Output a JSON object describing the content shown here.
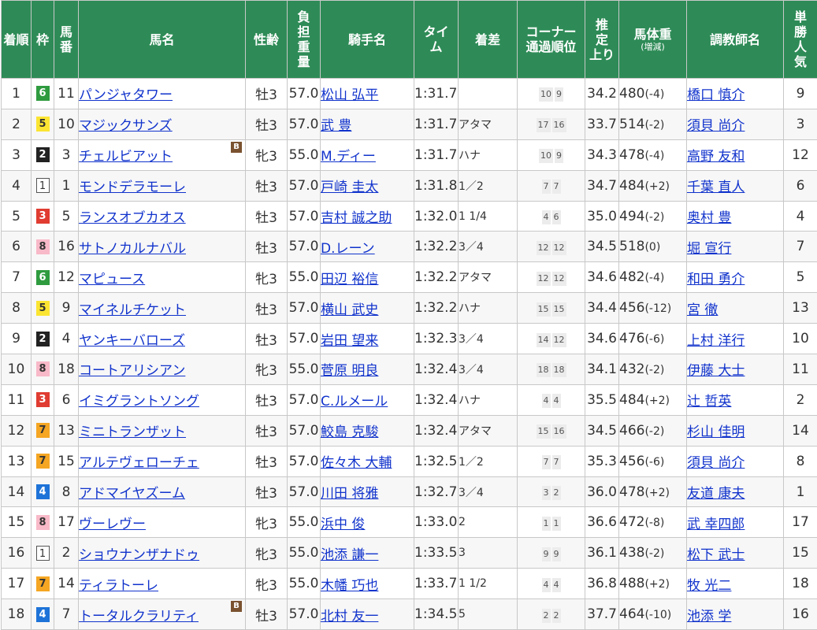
{
  "headers": {
    "finish": "着順",
    "frame": "枠",
    "horse_no": "馬番",
    "horse": "馬名",
    "sex_age": "性齢",
    "weight_carried": "負担重量",
    "jockey": "騎手名",
    "time": "タイム",
    "margin": "着差",
    "corner": "コーナー通過順位",
    "last3f": "推定上り",
    "horse_weight": "馬体重",
    "horse_weight_sub": "(増減)",
    "trainer": "調教師名",
    "popularity": "単勝人気"
  },
  "blinker_label": "B",
  "frame_colors": {
    "1": "#ffffff",
    "2": "#222222",
    "3": "#e03c31",
    "4": "#1e73d8",
    "5": "#fbe532",
    "6": "#2f9b3f",
    "7": "#f5a623",
    "8": "#f8b9c8"
  },
  "rows": [
    {
      "finish": "1",
      "frame": "6",
      "horse_no": "11",
      "horse": "パンジャタワー",
      "blinker": false,
      "sex_age": "牡3",
      "weight_carried": "57.0",
      "jockey": "松山 弘平",
      "time": "1:31.7",
      "margin": "",
      "corner": [
        "10",
        "9"
      ],
      "last3f": "34.2",
      "horse_weight": "480",
      "weight_diff": "(-4)",
      "trainer": "橋口 慎介",
      "popularity": "9"
    },
    {
      "finish": "2",
      "frame": "5",
      "horse_no": "10",
      "horse": "マジックサンズ",
      "blinker": false,
      "sex_age": "牡3",
      "weight_carried": "57.0",
      "jockey": "武 豊",
      "time": "1:31.7",
      "margin": "アタマ",
      "corner": [
        "17",
        "16"
      ],
      "last3f": "33.7",
      "horse_weight": "514",
      "weight_diff": "(-2)",
      "trainer": "須貝 尚介",
      "popularity": "3"
    },
    {
      "finish": "3",
      "frame": "2",
      "horse_no": "3",
      "horse": "チェルビアット",
      "blinker": true,
      "sex_age": "牝3",
      "weight_carried": "55.0",
      "jockey": "M.ディー",
      "time": "1:31.7",
      "margin": "ハナ",
      "corner": [
        "10",
        "9"
      ],
      "last3f": "34.3",
      "horse_weight": "478",
      "weight_diff": "(-4)",
      "trainer": "高野 友和",
      "popularity": "12"
    },
    {
      "finish": "4",
      "frame": "1",
      "horse_no": "1",
      "horse": "モンドデラモーレ",
      "blinker": false,
      "sex_age": "牡3",
      "weight_carried": "57.0",
      "jockey": "戸崎 圭太",
      "time": "1:31.8",
      "margin": "1／2",
      "corner": [
        "7",
        "7"
      ],
      "last3f": "34.7",
      "horse_weight": "484",
      "weight_diff": "(+2)",
      "trainer": "千葉 直人",
      "popularity": "6"
    },
    {
      "finish": "5",
      "frame": "3",
      "horse_no": "5",
      "horse": "ランスオブカオス",
      "blinker": false,
      "sex_age": "牡3",
      "weight_carried": "57.0",
      "jockey": "吉村 誠之助",
      "time": "1:32.0",
      "margin": "1 1/4",
      "corner": [
        "4",
        "6"
      ],
      "last3f": "35.0",
      "horse_weight": "494",
      "weight_diff": "(-2)",
      "trainer": "奥村 豊",
      "popularity": "4"
    },
    {
      "finish": "6",
      "frame": "8",
      "horse_no": "16",
      "horse": "サトノカルナバル",
      "blinker": false,
      "sex_age": "牡3",
      "weight_carried": "57.0",
      "jockey": "D.レーン",
      "time": "1:32.2",
      "margin": "3／4",
      "corner": [
        "12",
        "12"
      ],
      "last3f": "34.5",
      "horse_weight": "518",
      "weight_diff": "(0)",
      "trainer": "堀 宣行",
      "popularity": "7"
    },
    {
      "finish": "7",
      "frame": "6",
      "horse_no": "12",
      "horse": "マピュース",
      "blinker": false,
      "sex_age": "牝3",
      "weight_carried": "55.0",
      "jockey": "田辺 裕信",
      "time": "1:32.2",
      "margin": "アタマ",
      "corner": [
        "12",
        "12"
      ],
      "last3f": "34.6",
      "horse_weight": "482",
      "weight_diff": "(-4)",
      "trainer": "和田 勇介",
      "popularity": "5"
    },
    {
      "finish": "8",
      "frame": "5",
      "horse_no": "9",
      "horse": "マイネルチケット",
      "blinker": false,
      "sex_age": "牡3",
      "weight_carried": "57.0",
      "jockey": "横山 武史",
      "time": "1:32.2",
      "margin": "ハナ",
      "corner": [
        "15",
        "15"
      ],
      "last3f": "34.4",
      "horse_weight": "456",
      "weight_diff": "(-12)",
      "trainer": "宮 徹",
      "popularity": "13"
    },
    {
      "finish": "9",
      "frame": "2",
      "horse_no": "4",
      "horse": "ヤンキーバローズ",
      "blinker": false,
      "sex_age": "牡3",
      "weight_carried": "57.0",
      "jockey": "岩田 望来",
      "time": "1:32.3",
      "margin": "3／4",
      "corner": [
        "14",
        "12"
      ],
      "last3f": "34.6",
      "horse_weight": "476",
      "weight_diff": "(-6)",
      "trainer": "上村 洋行",
      "popularity": "10"
    },
    {
      "finish": "10",
      "frame": "8",
      "horse_no": "18",
      "horse": "コートアリシアン",
      "blinker": false,
      "sex_age": "牝3",
      "weight_carried": "55.0",
      "jockey": "菅原 明良",
      "time": "1:32.4",
      "margin": "3／4",
      "corner": [
        "18",
        "18"
      ],
      "last3f": "34.1",
      "horse_weight": "432",
      "weight_diff": "(-2)",
      "trainer": "伊藤 大士",
      "popularity": "11"
    },
    {
      "finish": "11",
      "frame": "3",
      "horse_no": "6",
      "horse": "イミグラントソング",
      "blinker": false,
      "sex_age": "牡3",
      "weight_carried": "57.0",
      "jockey": "C.ルメール",
      "time": "1:32.4",
      "margin": "ハナ",
      "corner": [
        "4",
        "4"
      ],
      "last3f": "35.5",
      "horse_weight": "484",
      "weight_diff": "(+2)",
      "trainer": "辻 哲英",
      "popularity": "2"
    },
    {
      "finish": "12",
      "frame": "7",
      "horse_no": "13",
      "horse": "ミニトランザット",
      "blinker": false,
      "sex_age": "牡3",
      "weight_carried": "57.0",
      "jockey": "鮫島 克駿",
      "time": "1:32.4",
      "margin": "アタマ",
      "corner": [
        "15",
        "16"
      ],
      "last3f": "34.5",
      "horse_weight": "466",
      "weight_diff": "(-2)",
      "trainer": "杉山 佳明",
      "popularity": "14"
    },
    {
      "finish": "13",
      "frame": "7",
      "horse_no": "15",
      "horse": "アルテヴェローチェ",
      "blinker": false,
      "sex_age": "牡3",
      "weight_carried": "57.0",
      "jockey": "佐々木 大輔",
      "time": "1:32.5",
      "margin": "1／2",
      "corner": [
        "7",
        "7"
      ],
      "last3f": "35.3",
      "horse_weight": "456",
      "weight_diff": "(-6)",
      "trainer": "須貝 尚介",
      "popularity": "8"
    },
    {
      "finish": "14",
      "frame": "4",
      "horse_no": "8",
      "horse": "アドマイヤズーム",
      "blinker": false,
      "sex_age": "牡3",
      "weight_carried": "57.0",
      "jockey": "川田 将雅",
      "time": "1:32.7",
      "margin": "3／4",
      "corner": [
        "3",
        "2"
      ],
      "last3f": "36.0",
      "horse_weight": "478",
      "weight_diff": "(+2)",
      "trainer": "友道 康夫",
      "popularity": "1"
    },
    {
      "finish": "15",
      "frame": "8",
      "horse_no": "17",
      "horse": "ヴーレヴー",
      "blinker": false,
      "sex_age": "牝3",
      "weight_carried": "55.0",
      "jockey": "浜中 俊",
      "time": "1:33.0",
      "margin": "2",
      "corner": [
        "1",
        "1"
      ],
      "last3f": "36.6",
      "horse_weight": "472",
      "weight_diff": "(-8)",
      "trainer": "武 幸四郎",
      "popularity": "17"
    },
    {
      "finish": "16",
      "frame": "1",
      "horse_no": "2",
      "horse": "ショウナンザナドゥ",
      "blinker": false,
      "sex_age": "牝3",
      "weight_carried": "55.0",
      "jockey": "池添 謙一",
      "time": "1:33.5",
      "margin": "3",
      "corner": [
        "9",
        "9"
      ],
      "last3f": "36.1",
      "horse_weight": "438",
      "weight_diff": "(-2)",
      "trainer": "松下 武士",
      "popularity": "15"
    },
    {
      "finish": "17",
      "frame": "7",
      "horse_no": "14",
      "horse": "ティラトーレ",
      "blinker": false,
      "sex_age": "牝3",
      "weight_carried": "55.0",
      "jockey": "木幡 巧也",
      "time": "1:33.7",
      "margin": "1 1/2",
      "corner": [
        "4",
        "4"
      ],
      "last3f": "36.8",
      "horse_weight": "488",
      "weight_diff": "(+2)",
      "trainer": "牧 光二",
      "popularity": "18"
    },
    {
      "finish": "18",
      "frame": "4",
      "horse_no": "7",
      "horse": "トータルクラリティ",
      "blinker": true,
      "sex_age": "牡3",
      "weight_carried": "57.0",
      "jockey": "北村 友一",
      "time": "1:34.5",
      "margin": "5",
      "corner": [
        "2",
        "2"
      ],
      "last3f": "37.7",
      "horse_weight": "464",
      "weight_diff": "(-10)",
      "trainer": "池添 学",
      "popularity": "16"
    }
  ]
}
